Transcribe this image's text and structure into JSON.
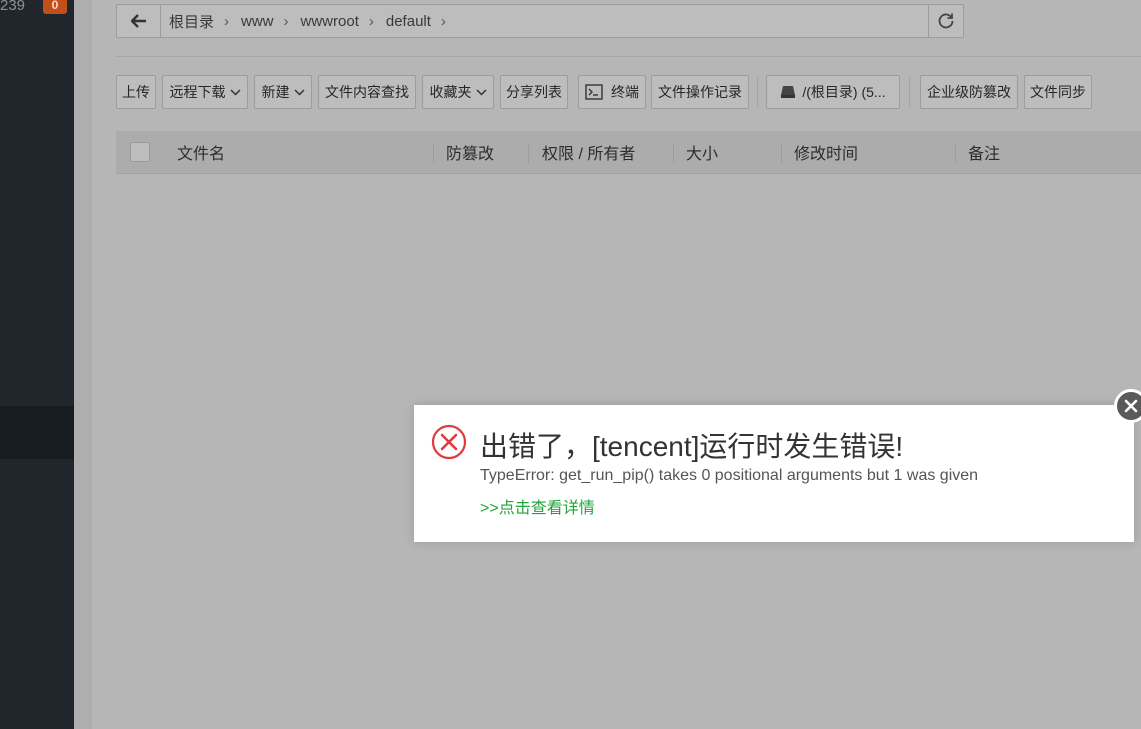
{
  "sidebar": {
    "count_text": "239",
    "badge": "0"
  },
  "pathbar": {
    "crumbs": [
      "根目录",
      "www",
      "wwwroot",
      "default"
    ]
  },
  "toolbar": {
    "upload": "上传",
    "remote_download": "远程下载",
    "new": "新建",
    "content_search": "文件内容查找",
    "favorites": "收藏夹",
    "share_list": "分享列表",
    "terminal": "终端",
    "operation_log": "文件操作记录",
    "disk": "/(根目录) (5...",
    "tamper_proof_enterprise": "企业级防篡改",
    "file_sync": "文件同步"
  },
  "table": {
    "columns": [
      "文件名",
      "防篡改",
      "权限 / 所有者",
      "大小",
      "修改时间",
      "备注"
    ]
  },
  "toast": {
    "title": "出错了，[tencent]运行时发生错误!",
    "message": "TypeError: get_run_pip() takes 0 positional arguments but 1 was given",
    "link": ">>点击查看详情"
  },
  "colors": {
    "sidebar_bg": "#20262b",
    "badge_bg": "#c24e1a",
    "error_red": "#e0393e",
    "link_green": "#20a53a"
  }
}
